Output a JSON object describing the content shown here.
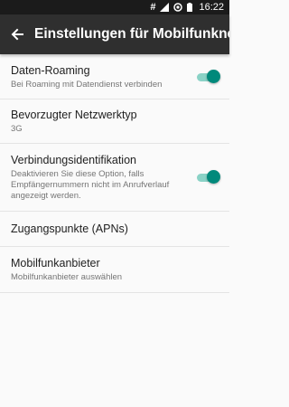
{
  "status_bar": {
    "time": "16:22",
    "icons": [
      "notification-hash-icon",
      "signal-icon",
      "data-saver-icon",
      "battery-icon"
    ],
    "hash_symbol": "#"
  },
  "toolbar": {
    "title": "Einstellungen für Mobilfunknetz",
    "back_icon": "arrow-back-icon"
  },
  "settings": [
    {
      "title": "Daten-Roaming",
      "summary": "Bei Roaming mit Datendienst verbinden",
      "toggle": true
    },
    {
      "title": "Bevorzugter Netzwerktyp",
      "summary": "3G"
    },
    {
      "title": "Verbindungsidentifikation",
      "summary": "Deaktivieren Sie diese Option, falls Empfängernummern nicht im Anrufverlauf angezeigt werden.",
      "toggle": true
    },
    {
      "title": "Zugangspunkte (APNs)"
    },
    {
      "title": "Mobilfunkanbieter",
      "summary": "Mobilfunkanbieter auswählen"
    }
  ],
  "colors": {
    "accent": "#00897b",
    "accent_track": "#8ad2c6",
    "toolbar": "#2f2f2f",
    "statusbar": "#1b1b1b",
    "background": "#fafafa"
  }
}
